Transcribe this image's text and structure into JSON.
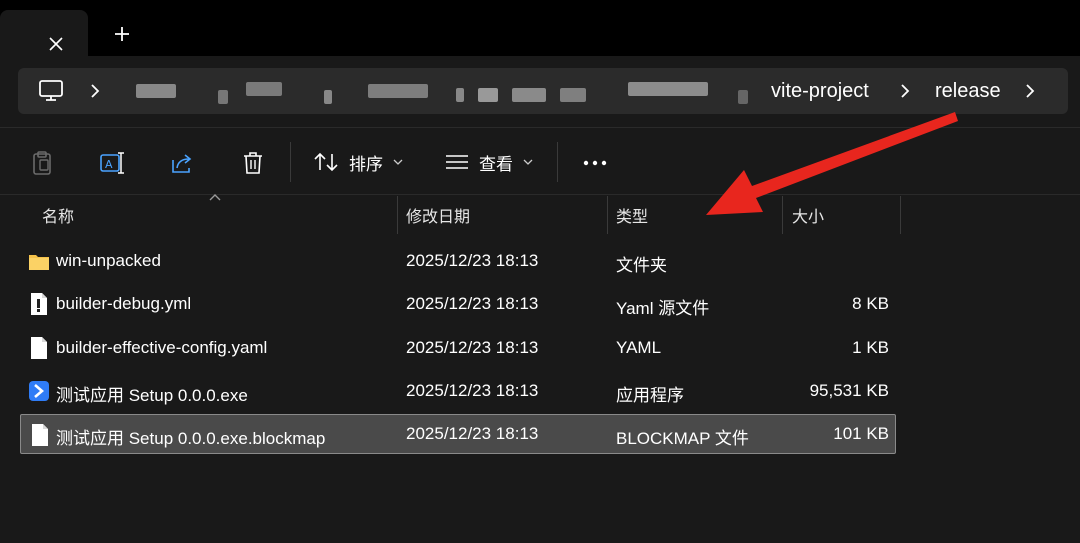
{
  "window": {
    "tab_close_glyph": "✕",
    "new_tab_glyph": "+"
  },
  "breadcrumb": {
    "items": [
      "vite-project",
      "release"
    ],
    "separator": "›"
  },
  "toolbar": {
    "sort_label": "排序",
    "view_label": "查看",
    "more_glyph": "···"
  },
  "columns": {
    "name": "名称",
    "modified": "修改日期",
    "type": "类型",
    "size": "大小"
  },
  "files": [
    {
      "name": "win-unpacked",
      "modified": "2025/12/23 18:13",
      "type": "文件夹",
      "size": "",
      "icon": "folder-icon"
    },
    {
      "name": "builder-debug.yml",
      "modified": "2025/12/23 18:13",
      "type": "Yaml 源文件",
      "size": "8 KB",
      "icon": "yaml-file-icon"
    },
    {
      "name": "builder-effective-config.yaml",
      "modified": "2025/12/23 18:13",
      "type": "YAML",
      "size": "1 KB",
      "icon": "file-icon"
    },
    {
      "name": "测试应用 Setup 0.0.0.exe",
      "modified": "2025/12/23 18:13",
      "type": "应用程序",
      "size": "95,531 KB",
      "icon": "app-icon"
    },
    {
      "name": "测试应用 Setup 0.0.0.exe.blockmap",
      "modified": "2025/12/23 18:13",
      "type": "BLOCKMAP 文件",
      "size": "101 KB",
      "icon": "file-icon",
      "selected": true
    }
  ],
  "colors": {
    "background": "#191919",
    "tabstrip": "#000000",
    "addressbar": "#2b2b2b",
    "selection": "#4a4a4a",
    "folder": "#f5c24a",
    "app_icon": "#2f7cf6",
    "annotation_arrow": "#e8261e"
  }
}
